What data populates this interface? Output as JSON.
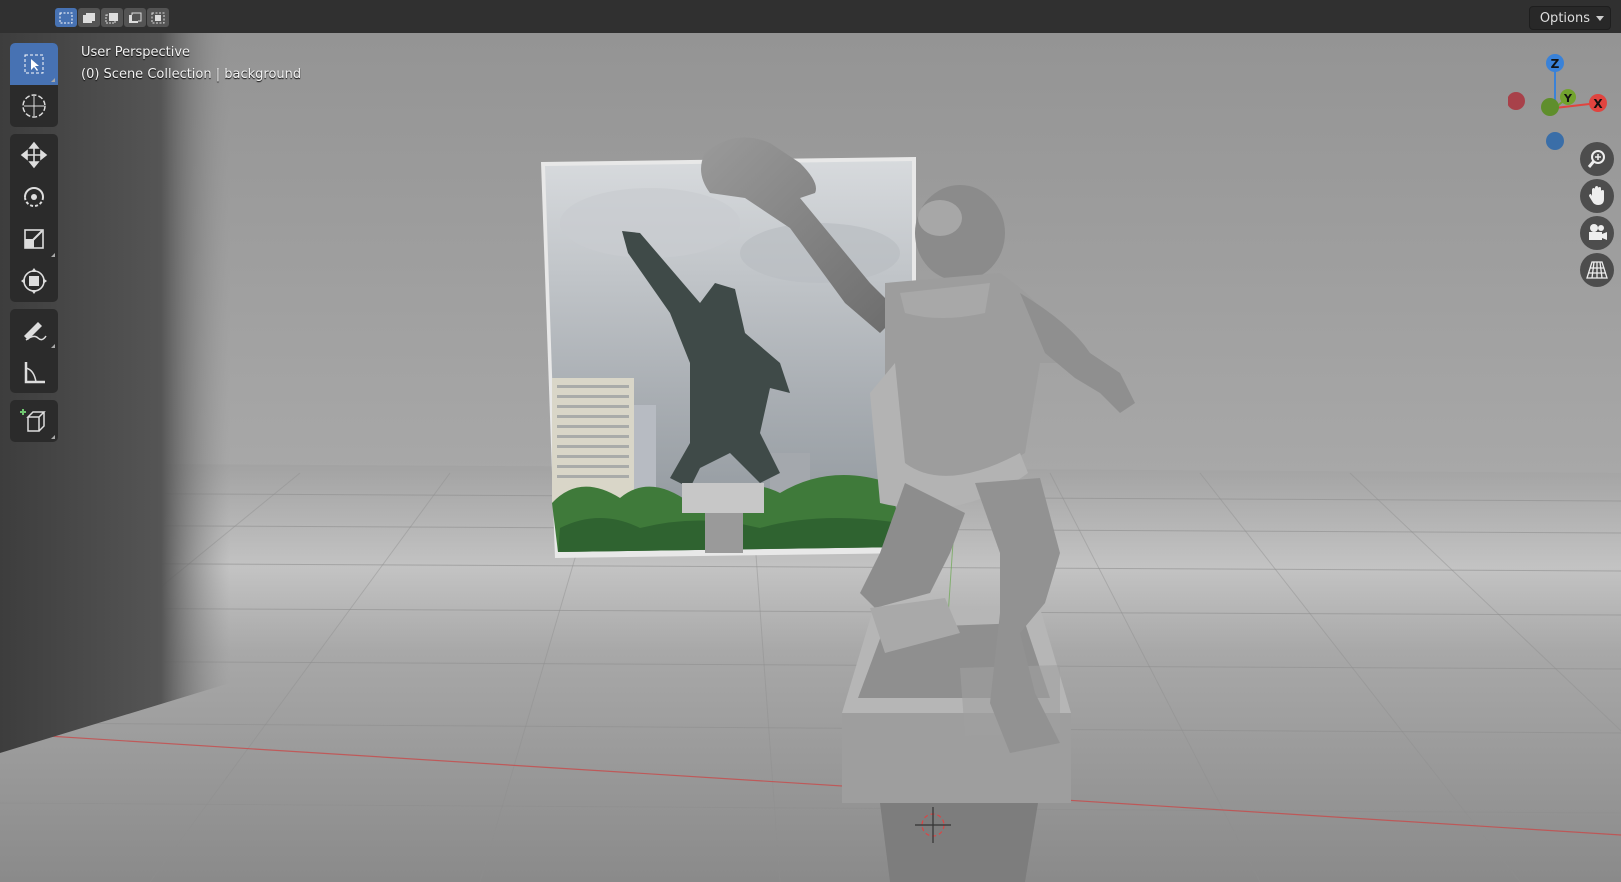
{
  "header": {
    "select_modes": [
      "mode-new",
      "mode-extend",
      "mode-subtract",
      "mode-difference",
      "mode-intersect"
    ],
    "options_label": "Options"
  },
  "viewport": {
    "view_name": "User Perspective",
    "collection_info": "(0) Scene Collection | background"
  },
  "toolbar": {
    "tools": [
      "select-box-icon",
      "cursor-icon",
      "move-icon",
      "rotate-icon",
      "scale-icon",
      "transform-icon",
      "annotate-icon",
      "measure-icon",
      "add-cube-icon"
    ]
  },
  "gizmo": {
    "axes": [
      "Z",
      "Y",
      "X"
    ],
    "colors": {
      "x": "#e0443f",
      "y": "#72a32e",
      "z": "#3a82d8"
    }
  },
  "navigation": [
    "zoom-icon",
    "hand-pan-icon",
    "camera-icon",
    "perspective-grid-icon"
  ]
}
